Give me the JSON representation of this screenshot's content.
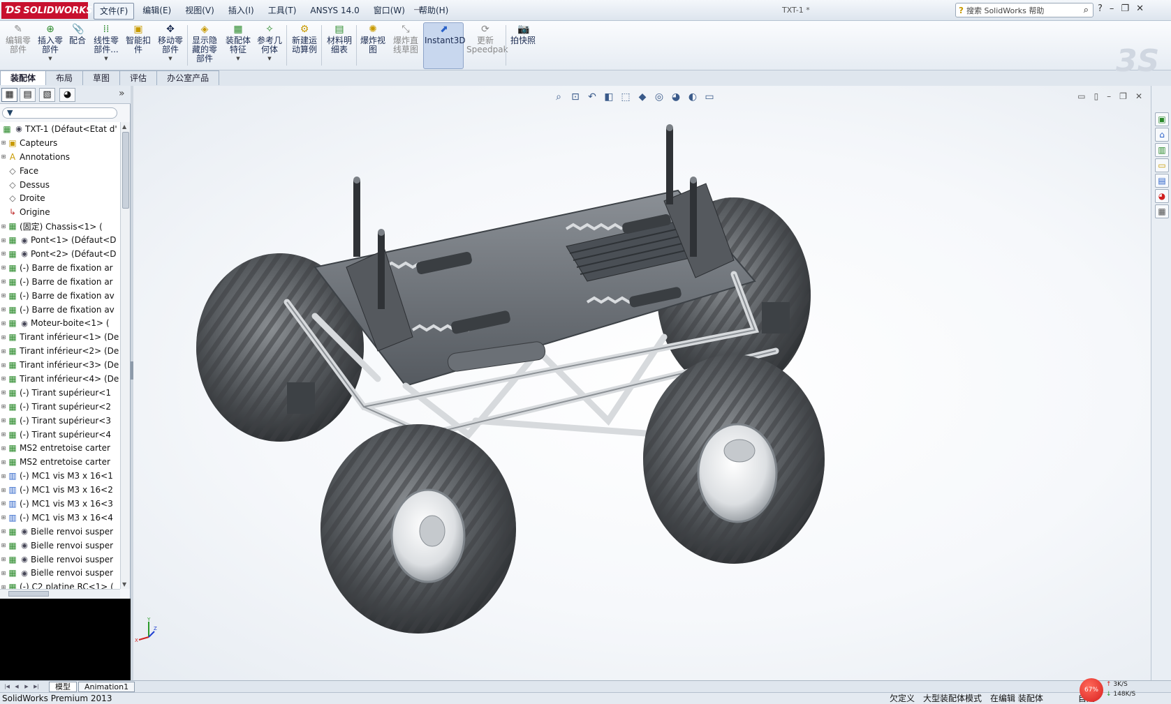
{
  "app": {
    "logo": "SOLIDWORKS",
    "doc_title": "TXT-1 *",
    "menu": [
      "文件(F)",
      "编辑(E)",
      "视图(V)",
      "插入(I)",
      "工具(T)",
      "ANSYS 14.0",
      "窗口(W)",
      "帮助(H)"
    ],
    "help_search_placeholder": "搜索 SolidWorks 帮助"
  },
  "toolbar": {
    "tools": [
      {
        "label": "编辑零\n部件",
        "icon": "edit-component-icon"
      },
      {
        "label": "插入零\n部件",
        "icon": "insert-component-icon"
      },
      {
        "label": "配合",
        "icon": "mate-icon"
      },
      {
        "label": "线性零\n部件...",
        "icon": "linear-pattern-icon"
      },
      {
        "label": "智能扣\n件",
        "icon": "smart-fastener-icon"
      },
      {
        "label": "移动零\n部件",
        "icon": "move-component-icon"
      },
      {
        "label": "显示隐\n藏的零\n部件",
        "icon": "show-hidden-icon"
      },
      {
        "label": "装配体\n特征",
        "icon": "assembly-feature-icon"
      },
      {
        "label": "参考几\n何体",
        "icon": "reference-geometry-icon"
      },
      {
        "label": "新建运\n动算例",
        "icon": "new-motion-study-icon"
      },
      {
        "label": "材料明\n细表",
        "icon": "bom-icon"
      },
      {
        "label": "爆炸视\n图",
        "icon": "exploded-view-icon"
      },
      {
        "label": "爆炸直\n线草图",
        "icon": "explode-line-sketch-icon"
      },
      {
        "label": "Instant3D",
        "icon": "instant3d-icon"
      },
      {
        "label": "更新\nSpeedpak",
        "icon": "speedpak-icon"
      },
      {
        "label": "拍快照",
        "icon": "snapshot-icon"
      }
    ]
  },
  "command_tabs": [
    "装配体",
    "布局",
    "草图",
    "评估",
    "办公室产品"
  ],
  "feature_tree": {
    "root": "TXT-1  (Défaut<Etat d'",
    "items": [
      {
        "label": "Capteurs",
        "icon": "sensors-icon"
      },
      {
        "label": "Annotations",
        "icon": "annotations-icon"
      },
      {
        "label": "Face",
        "icon": "plane-icon"
      },
      {
        "label": "Dessus",
        "icon": "plane-icon"
      },
      {
        "label": "Droite",
        "icon": "plane-icon"
      },
      {
        "label": "Origine",
        "icon": "origin-icon"
      },
      {
        "label": "(固定) Chassis<1> (",
        "icon": "part-icon"
      },
      {
        "label": "Pont<1> (Défaut<D",
        "icon": "subassembly-icon"
      },
      {
        "label": "Pont<2> (Défaut<D",
        "icon": "subassembly-icon"
      },
      {
        "label": "(-) Barre de fixation ar",
        "icon": "part-icon"
      },
      {
        "label": "(-) Barre de fixation ar",
        "icon": "part-icon"
      },
      {
        "label": "(-) Barre de fixation av",
        "icon": "part-icon"
      },
      {
        "label": "(-) Barre de fixation av",
        "icon": "part-icon"
      },
      {
        "label": "Moteur-boite<1> (",
        "icon": "subassembly-icon"
      },
      {
        "label": "Tirant inférieur<1> (De",
        "icon": "part-icon"
      },
      {
        "label": "Tirant inférieur<2> (De",
        "icon": "part-icon"
      },
      {
        "label": "Tirant inférieur<3> (De",
        "icon": "part-icon"
      },
      {
        "label": "Tirant inférieur<4> (De",
        "icon": "part-icon"
      },
      {
        "label": "(-) Tirant supérieur<1",
        "icon": "part-icon"
      },
      {
        "label": "(-) Tirant supérieur<2",
        "icon": "part-icon"
      },
      {
        "label": "(-) Tirant supérieur<3",
        "icon": "part-icon"
      },
      {
        "label": "(-) Tirant supérieur<4",
        "icon": "part-icon"
      },
      {
        "label": "MS2 entretoise carter",
        "icon": "part-icon"
      },
      {
        "label": "MS2 entretoise carter",
        "icon": "part-icon"
      },
      {
        "label": "(-) MC1 vis M3 x 16<1",
        "icon": "screw-icon"
      },
      {
        "label": "(-) MC1 vis M3 x 16<2",
        "icon": "screw-icon"
      },
      {
        "label": "(-) MC1 vis M3 x 16<3",
        "icon": "screw-icon"
      },
      {
        "label": "(-) MC1 vis M3 x 16<4",
        "icon": "screw-icon"
      },
      {
        "label": "Bielle renvoi susper",
        "icon": "subassembly-icon"
      },
      {
        "label": "Bielle renvoi susper",
        "icon": "subassembly-icon"
      },
      {
        "label": "Bielle renvoi susper",
        "icon": "subassembly-icon"
      },
      {
        "label": "Bielle renvoi susper",
        "icon": "subassembly-icon"
      },
      {
        "label": "(-) C2 platine RC<1> (",
        "icon": "part-icon"
      }
    ]
  },
  "bottom_tabs": [
    "模型",
    "Animation1"
  ],
  "status": {
    "app": "SolidWorks Premium 2013",
    "right": [
      "欠定义",
      "大型装配体模式",
      "在编辑 装配体",
      "自定"
    ]
  },
  "net_widget": {
    "percent": "67%",
    "up": "3K/S",
    "down": "148K/S"
  },
  "colors": {
    "accent": "#c8102e",
    "viewport_bg": "#ffffff",
    "model_gray": "#5f6469"
  }
}
